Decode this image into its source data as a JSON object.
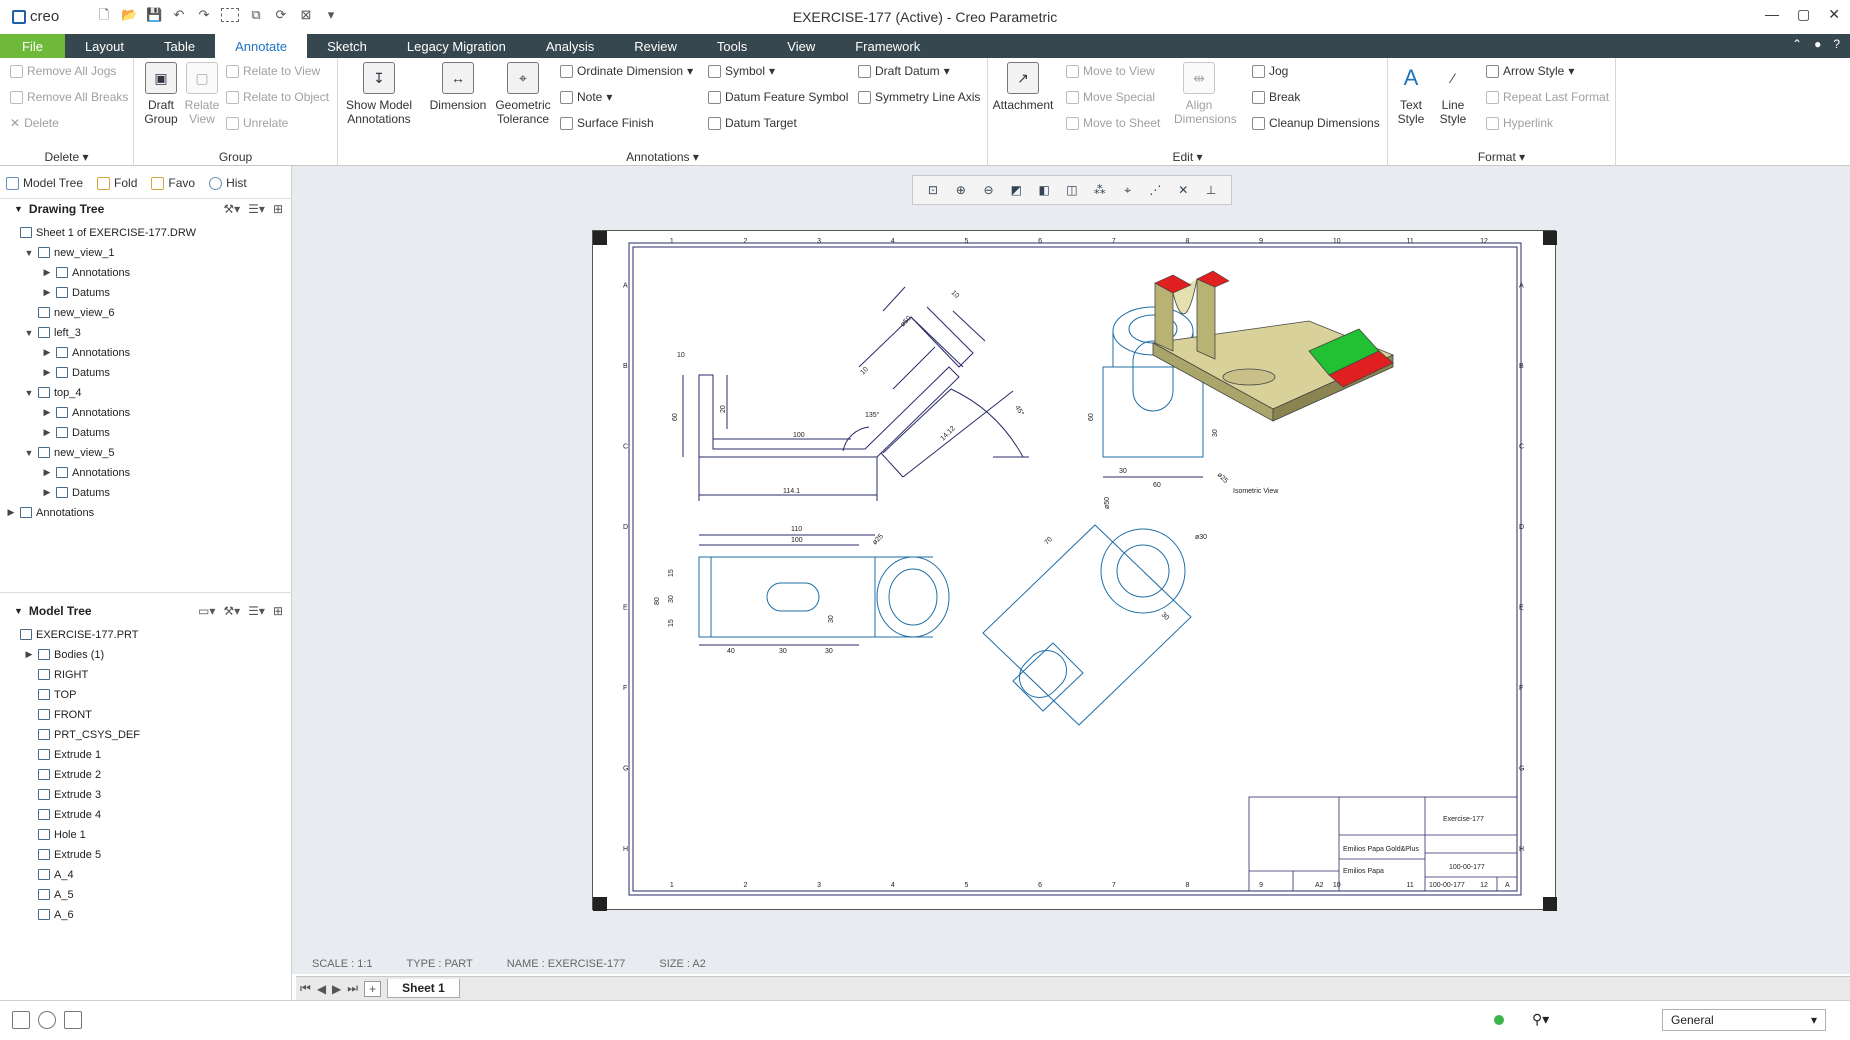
{
  "app": {
    "logo": "creo",
    "title": "EXERCISE-177 (Active) - Creo Parametric",
    "win_min": "—",
    "win_max": "▢",
    "win_close": "✕"
  },
  "qat": [
    "new-icon",
    "open-icon",
    "save-icon",
    "undo-icon",
    "redo-icon",
    "select-box-icon",
    "windows-icon",
    "regenerate-icon",
    "close-window-icon",
    "customize-icon"
  ],
  "tabs": [
    "File",
    "Layout",
    "Table",
    "Annotate",
    "Sketch",
    "Legacy Migration",
    "Analysis",
    "Review",
    "Tools",
    "View",
    "Framework"
  ],
  "active_tab": "Annotate",
  "ribbon": {
    "delete": {
      "label": "Delete",
      "items": [
        "Remove All Jogs",
        "Remove All Breaks",
        "Delete"
      ]
    },
    "group": {
      "label": "Group",
      "draft_group": "Draft\nGroup",
      "relate_view": "Relate\nView",
      "items": [
        "Relate to View",
        "Relate to Object",
        "Unrelate"
      ]
    },
    "annotations": {
      "label": "Annotations",
      "show_model": "Show Model\nAnnotations",
      "dimension": "Dimension",
      "geometric": "Geometric\nTolerance",
      "col1": [
        "Ordinate Dimension",
        "Note",
        "Surface Finish"
      ],
      "col2": [
        "Symbol",
        "Datum Feature Symbol",
        "Datum Target"
      ],
      "col3": [
        "Draft Datum",
        "Symmetry Line Axis"
      ]
    },
    "edit": {
      "label": "Edit",
      "attachment": "Attachment",
      "align": "Align\nDimensions",
      "col1": [
        "Move to View",
        "Move Special",
        "Move to Sheet"
      ],
      "col2": [
        "Jog",
        "Break",
        "Cleanup Dimensions"
      ]
    },
    "format": {
      "label": "Format",
      "text_style": "Text\nStyle",
      "line_style": "Line\nStyle",
      "items": [
        "Arrow Style",
        "Repeat Last Format",
        "Hyperlink"
      ]
    }
  },
  "nav_tabs": [
    "Model Tree",
    "Fold",
    "Favo",
    "Hist"
  ],
  "drawing_tree": {
    "header": "Drawing Tree",
    "rows": [
      {
        "text": "Sheet 1 of EXERCISE-177.DRW",
        "level": 0,
        "arrow": ""
      },
      {
        "text": "new_view_1",
        "level": 1,
        "arrow": "▼"
      },
      {
        "text": "Annotations",
        "level": 2,
        "arrow": "▶"
      },
      {
        "text": "Datums",
        "level": 2,
        "arrow": "▶"
      },
      {
        "text": "new_view_6",
        "level": 1,
        "arrow": ""
      },
      {
        "text": "left_3",
        "level": 1,
        "arrow": "▼"
      },
      {
        "text": "Annotations",
        "level": 2,
        "arrow": "▶"
      },
      {
        "text": "Datums",
        "level": 2,
        "arrow": "▶"
      },
      {
        "text": "top_4",
        "level": 1,
        "arrow": "▼"
      },
      {
        "text": "Annotations",
        "level": 2,
        "arrow": "▶"
      },
      {
        "text": "Datums",
        "level": 2,
        "arrow": "▶"
      },
      {
        "text": "new_view_5",
        "level": 1,
        "arrow": "▼"
      },
      {
        "text": "Annotations",
        "level": 2,
        "arrow": "▶"
      },
      {
        "text": "Datums",
        "level": 2,
        "arrow": "▶"
      },
      {
        "text": "Annotations",
        "level": 0,
        "arrow": "▶"
      }
    ]
  },
  "model_tree": {
    "header": "Model Tree",
    "rows": [
      {
        "text": "EXERCISE-177.PRT",
        "level": 0,
        "arrow": ""
      },
      {
        "text": "Bodies (1)",
        "level": 1,
        "arrow": "▶"
      },
      {
        "text": "RIGHT",
        "level": 1,
        "arrow": ""
      },
      {
        "text": "TOP",
        "level": 1,
        "arrow": ""
      },
      {
        "text": "FRONT",
        "level": 1,
        "arrow": ""
      },
      {
        "text": "PRT_CSYS_DEF",
        "level": 1,
        "arrow": ""
      },
      {
        "text": "Extrude 1",
        "level": 1,
        "arrow": ""
      },
      {
        "text": "Extrude 2",
        "level": 1,
        "arrow": ""
      },
      {
        "text": "Extrude 3",
        "level": 1,
        "arrow": ""
      },
      {
        "text": "Extrude 4",
        "level": 1,
        "arrow": ""
      },
      {
        "text": "Hole 1",
        "level": 1,
        "arrow": ""
      },
      {
        "text": "Extrude 5",
        "level": 1,
        "arrow": ""
      },
      {
        "text": "A_4",
        "level": 1,
        "arrow": ""
      },
      {
        "text": "A_5",
        "level": 1,
        "arrow": ""
      },
      {
        "text": "A_6",
        "level": 1,
        "arrow": ""
      }
    ]
  },
  "view_toolbar": [
    "refit-icon",
    "zoom-in-icon",
    "zoom-out-icon",
    "repaint-icon",
    "display-style-icon",
    "saved-views-icon",
    "datum-display-icon",
    "annotation-display-icon",
    "point-display-icon",
    "csys-display-icon",
    "axis-display-icon",
    "plane-display-icon"
  ],
  "drawing": {
    "border_numbers": [
      "1",
      "2",
      "3",
      "4",
      "5",
      "6",
      "7",
      "8",
      "9",
      "10",
      "11",
      "12"
    ],
    "border_letters": [
      "A",
      "B",
      "C",
      "D",
      "E",
      "F",
      "G",
      "H"
    ],
    "dims_front": [
      "10",
      "20",
      "60",
      "100",
      "114.1",
      "135°",
      "10",
      "ø50",
      "10",
      "45°",
      "14.12"
    ],
    "dims_side": [
      "60",
      "30",
      "30",
      "60",
      "ø25"
    ],
    "dims_top": [
      "110",
      "100",
      "ø25",
      "15",
      "30",
      "15",
      "80",
      "30",
      "40",
      "30",
      "30"
    ],
    "dims_aux": [
      "ø50",
      "ø30",
      "70",
      "30"
    ],
    "iso_label": "Isometric View",
    "titleblock": {
      "title": "Exercise-177",
      "name": "Emilios Papa",
      "dwg_no": "100-00-177",
      "dwg_no2": "100-00-177",
      "size": "A2",
      "rev": "A",
      "company": "Emilios Papa Gold&Plus"
    }
  },
  "status_info": [
    "SCALE : 1:1",
    "TYPE : PART",
    "NAME : EXERCISE-177",
    "SIZE : A2"
  ],
  "sheet_tab": "Sheet 1",
  "sheet_nav": [
    "⏮",
    "◀",
    "▶",
    "⏭",
    "+"
  ],
  "filter": "General",
  "colors": {
    "tabbar": "#36474f",
    "file": "#6fb93a",
    "line": "#2a2a6a",
    "model": "#1f6fa8",
    "iso_body": "#d8d29a",
    "iso_green": "#22c033",
    "iso_red": "#e02020"
  }
}
